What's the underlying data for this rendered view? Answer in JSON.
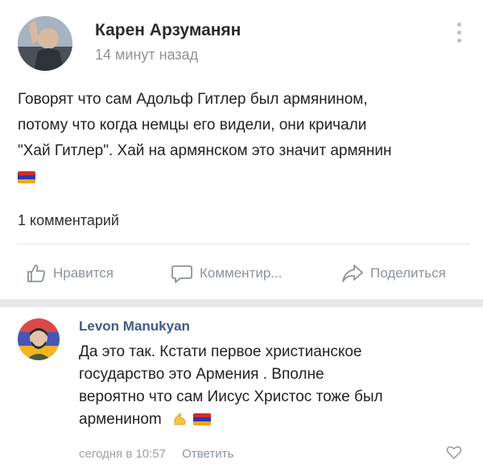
{
  "post": {
    "author": "Карен Арзуманян",
    "time": "14 минут назад",
    "text_lines": [
      "Говорят что сам Адольф Гитлер был армянином,",
      "потому что когда немцы его видели, они кричали",
      "\"Хай Гитлер\". Хай на армянском это значит армянин"
    ],
    "flag_icon": "armenian-flag-icon",
    "comment_count": "1 комментарий"
  },
  "actions": {
    "like_label": "Нравится",
    "comment_label": "Комментир...",
    "share_label": "Поделиться"
  },
  "comment": {
    "author": "Levon Manukyan",
    "text_lines": [
      "Да это так. Кстати первое христианское",
      "государство это Армения . Вполне",
      "вероятно что сам Иисус Христос тоже был",
      "армениноm"
    ],
    "time": "сегодня в 10:57",
    "reply_label": "Ответить"
  },
  "colors": {
    "accent": "#3f5c83",
    "muted": "#8a939e",
    "flag_red": "#d52b2b",
    "flag_blue": "#2a39a8",
    "flag_orange": "#f2a800"
  }
}
